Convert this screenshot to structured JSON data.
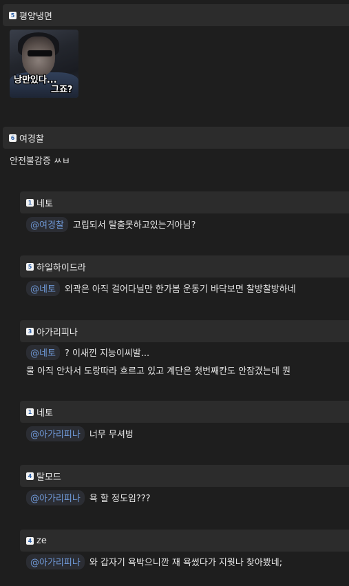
{
  "comments": [
    {
      "level": "5",
      "nick": "평양냉면"
    },
    {
      "level": "6",
      "nick": "여경찰",
      "text": "안전불감증 ㅆㅂ"
    },
    {
      "level": "1",
      "nick": "네토",
      "mention": "@여경찰",
      "text": "고립되서 탈출못하고있는거아님?"
    },
    {
      "level": "5",
      "nick": "하일하이드라",
      "mention": "@네토",
      "text": "외곽은 아직 걸어다닐만 한가봄 운동기 바닥보면 찰방찰방하네"
    },
    {
      "level": "3",
      "nick": "아가리피나",
      "mention": "@네토",
      "text": "? 이새낀 지능이씨발...",
      "text2": "물 아직 안차서 도랑따라 흐르고 있고 계단은 첫번째칸도 안잠겼는데 뭔"
    },
    {
      "level": "1",
      "nick": "네토",
      "mention": "@아가리피나",
      "text": "너무 무셔벙"
    },
    {
      "level": "4",
      "nick": "탈모드",
      "mention": "@아가리피나",
      "text": "욕 할 정도임???"
    },
    {
      "level": "4",
      "nick": "ze",
      "mention": "@아가리피나",
      "text": "와 갑자기 욕박으니깐 재 욕썼다가 지웟나 찾아봤네;"
    }
  ],
  "image_caption": {
    "line1": "낭만있다...",
    "line2": "그죠?"
  }
}
